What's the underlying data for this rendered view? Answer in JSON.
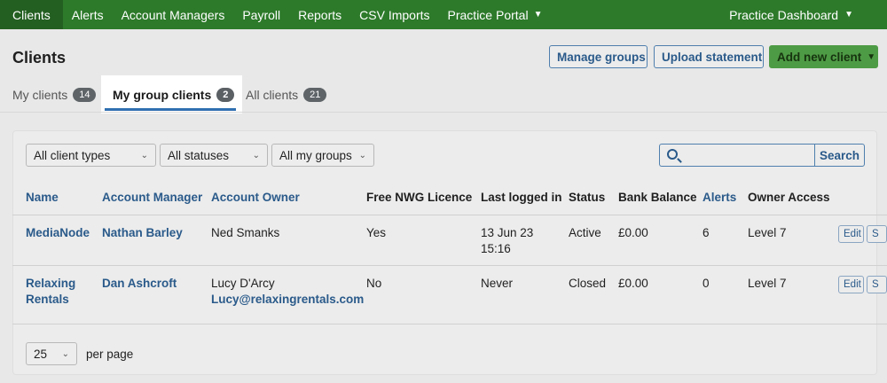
{
  "nav": {
    "items": [
      {
        "label": "Clients"
      },
      {
        "label": "Alerts"
      },
      {
        "label": "Account Managers"
      },
      {
        "label": "Payroll"
      },
      {
        "label": "Reports"
      },
      {
        "label": "CSV Imports"
      },
      {
        "label": "Practice Portal"
      }
    ],
    "right_label": "Practice Dashboard"
  },
  "page": {
    "title": "Clients",
    "buttons": {
      "manage_groups": "Manage groups",
      "upload_statement": "Upload statement",
      "add_new_client": "Add new client"
    }
  },
  "tabs": [
    {
      "label": "My clients",
      "count": "14"
    },
    {
      "label": "My group clients",
      "count": "2",
      "active": true
    },
    {
      "label": "All clients",
      "count": "21"
    }
  ],
  "filters": {
    "client_types": "All client types",
    "statuses": "All statuses",
    "groups": "All my groups",
    "search_value": "",
    "search_button": "Search"
  },
  "table": {
    "headers": [
      "Name",
      "Account Manager",
      "Account Owner",
      "Free NWG Licence",
      "Last logged in",
      "Status",
      "Bank Balance",
      "Alerts",
      "Owner Access"
    ],
    "rows": [
      {
        "name_line1": "MediaNode",
        "name_line2": "",
        "manager": "Nathan Barley",
        "owner": "Ned Smanks",
        "owner_email": "",
        "licence": "Yes",
        "last_login_line1": "13 Jun 23",
        "last_login_line2": "15:16",
        "status": "Active",
        "balance": "£0.00",
        "alerts": "6",
        "access": "Level 7",
        "edit": "Edit",
        "second_action": "S"
      },
      {
        "name_line1": "Relaxing",
        "name_line2": "Rentals",
        "manager": "Dan Ashcroft",
        "owner": "Lucy D'Arcy",
        "owner_email": "Lucy@relaxingrentals.com",
        "licence": "No",
        "last_login_line1": "Never",
        "last_login_line2": "",
        "status": "Closed",
        "balance": "£0.00",
        "alerts": "0",
        "access": "Level 7",
        "edit": "Edit",
        "second_action": "S"
      }
    ]
  },
  "pagination": {
    "per_page_value": "25",
    "per_page_label": "per page"
  },
  "colors": {
    "nav_green": "#2d7a2a",
    "link_blue": "#2a5a8a",
    "add_button_green": "#4e9b45",
    "tab_underline": "#2f6fb0"
  }
}
